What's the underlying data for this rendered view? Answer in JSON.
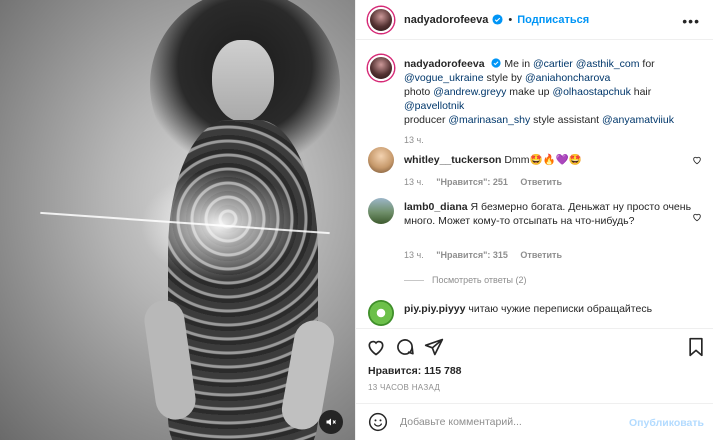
{
  "post": {
    "username": "nadyadorofeeva",
    "follow_label": "Подписаться",
    "separator": "•",
    "more_label": "•••"
  },
  "caption": {
    "username": "nadyadorofeeva",
    "text_1": "Me in ",
    "mention_1": "@cartier",
    "mention_2": "@asthik_com",
    "text_2": " for ",
    "mention_3": "@vogue_ukraine",
    "text_3": " style by ",
    "mention_4": "@aniahoncharova",
    "text_4": "photo ",
    "mention_5": "@andrew.greyy",
    "text_5": " make up ",
    "mention_6": "@olhaostapchuk",
    "text_6": " hair ",
    "mention_7": "@pavellotnik",
    "text_7": "producer ",
    "mention_8": "@marinasan_shy",
    "text_8": " style assistant ",
    "mention_9": "@anyamatviiuk",
    "time": "13 ч."
  },
  "comments": [
    {
      "username": "whitley__tuckerson",
      "text": "Dmm🤩🔥💜🤩",
      "time": "13 ч.",
      "likes": "\"Нравится\": 251",
      "reply": "Ответить"
    },
    {
      "username": "lamb0_diana",
      "text": "Я безмерно богата. Деньжат ну просто очень много. Может кому-то отсыпать на что-нибудь?",
      "time": "13 ч.",
      "likes": "\"Нравится\": 315",
      "reply": "Ответить",
      "view_replies": "Посмотреть ответы (2)"
    },
    {
      "username": "piy.piy.piyyy",
      "text": "читаю чужие переписки обращайтесь"
    }
  ],
  "stats": {
    "likes": "Нравится: 115 788",
    "time": "13 ЧАСОВ НАЗАД"
  },
  "add_comment": {
    "placeholder": "Добавьте комментарий...",
    "publish_label": "Опубликовать"
  },
  "colors": {
    "accent": "#0095f6",
    "link": "#00376b",
    "muted": "#8e8e8e",
    "publish_disabled": "#b3dbff"
  },
  "icons": {
    "verified": "verified-badge-icon",
    "like": "heart-icon",
    "comment": "comment-bubble-icon",
    "share": "paper-plane-icon",
    "save": "bookmark-icon",
    "emoji": "smiley-icon",
    "mute": "speaker-muted-icon"
  }
}
